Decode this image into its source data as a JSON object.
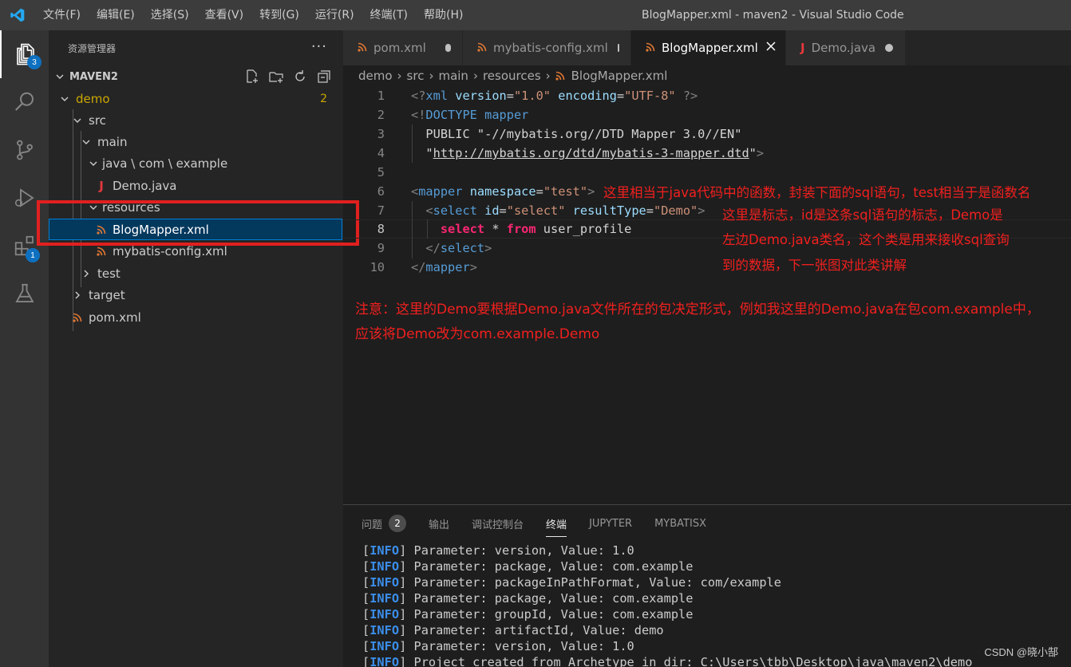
{
  "titlebar": {
    "menu": [
      "文件(F)",
      "编辑(E)",
      "选择(S)",
      "查看(V)",
      "转到(G)",
      "运行(R)",
      "终端(T)",
      "帮助(H)"
    ],
    "window_title": "BlogMapper.xml - maven2 - Visual Studio Code",
    "accent": "#23a9f2"
  },
  "activitybar": {
    "explorer_badge": "3",
    "extensions_badge": "1"
  },
  "sidebar": {
    "title": "资源管理器",
    "more": "···",
    "section": "MAVEN2",
    "tree": [
      {
        "label": "demo",
        "type": "folder-open",
        "count": "2",
        "color": "#cca700"
      },
      {
        "label": "src",
        "type": "folder-open"
      },
      {
        "label": "main",
        "type": "folder-open"
      },
      {
        "label": "java \\ com \\ example",
        "type": "folder-open"
      },
      {
        "label": "Demo.java",
        "type": "java"
      },
      {
        "label": "resources",
        "type": "folder-open"
      },
      {
        "label": "BlogMapper.xml",
        "type": "xml"
      },
      {
        "label": "mybatis-config.xml",
        "type": "xml"
      },
      {
        "label": "test",
        "type": "folder-closed"
      },
      {
        "label": "target",
        "type": "folder-closed"
      },
      {
        "label": "pom.xml",
        "type": "xml"
      }
    ]
  },
  "tabs": [
    {
      "label": "pom.xml",
      "icon": "xml"
    },
    {
      "label": "mybatis-config.xml",
      "icon": "xml"
    },
    {
      "label": "BlogMapper.xml",
      "icon": "xml"
    },
    {
      "label": "Demo.java",
      "icon": "java"
    }
  ],
  "breadcrumb": [
    "demo",
    "src",
    "main",
    "resources",
    "BlogMapper.xml"
  ],
  "editor": {
    "line_numbers": [
      "1",
      "2",
      "3",
      "4",
      "5",
      "6",
      "7",
      "8",
      "9",
      "10"
    ],
    "lines": [
      "<?xml version=\"1.0\" encoding=\"UTF-8\" ?>",
      "<!DOCTYPE mapper",
      "  PUBLIC \"-//mybatis.org//DTD Mapper 3.0//EN\"",
      "  \"http://mybatis.org/dtd/mybatis-3-mapper.dtd\">",
      "",
      "<mapper namespace=\"test\">",
      "  <select id=\"select\" resultType=\"Demo\">",
      "    select * from user_profile",
      "  </select>",
      "</mapper>"
    ],
    "annotations": {
      "a1": "这里相当于java代码中的函数，封装下面的sql语句，test相当于是函数名",
      "a2": "这里是标志，id是这条sql语句的标志，Demo是",
      "a3": "左边Demo.java类名，这个类是用来接收sql查询",
      "a4": "到的数据，下一张图对此类讲解",
      "note1": "注意：这里的Demo要根据Demo.java文件所在的包决定形式，例如我这里的Demo.java在包com.example中，",
      "note2": "应该将Demo改为com.example.Demo"
    }
  },
  "panel": {
    "tabs": [
      "问题",
      "输出",
      "调试控制台",
      "终端",
      "JUPYTER",
      "MYBATISX"
    ],
    "problems_count": "2",
    "info_tag": "INFO",
    "lines": [
      "Parameter: version, Value: 1.0",
      "Parameter: package, Value: com.example",
      "Parameter: packageInPathFormat, Value: com/example",
      "Parameter: package, Value: com.example",
      "Parameter: groupId, Value: com.example",
      "Parameter: artifactId, Value: demo",
      "Parameter: version, Value: 1.0",
      "Project created from Archetype in dir: C:\\Users\\tbb\\Desktop\\java\\maven2\\demo"
    ]
  },
  "watermark": "CSDN @晓小郜"
}
